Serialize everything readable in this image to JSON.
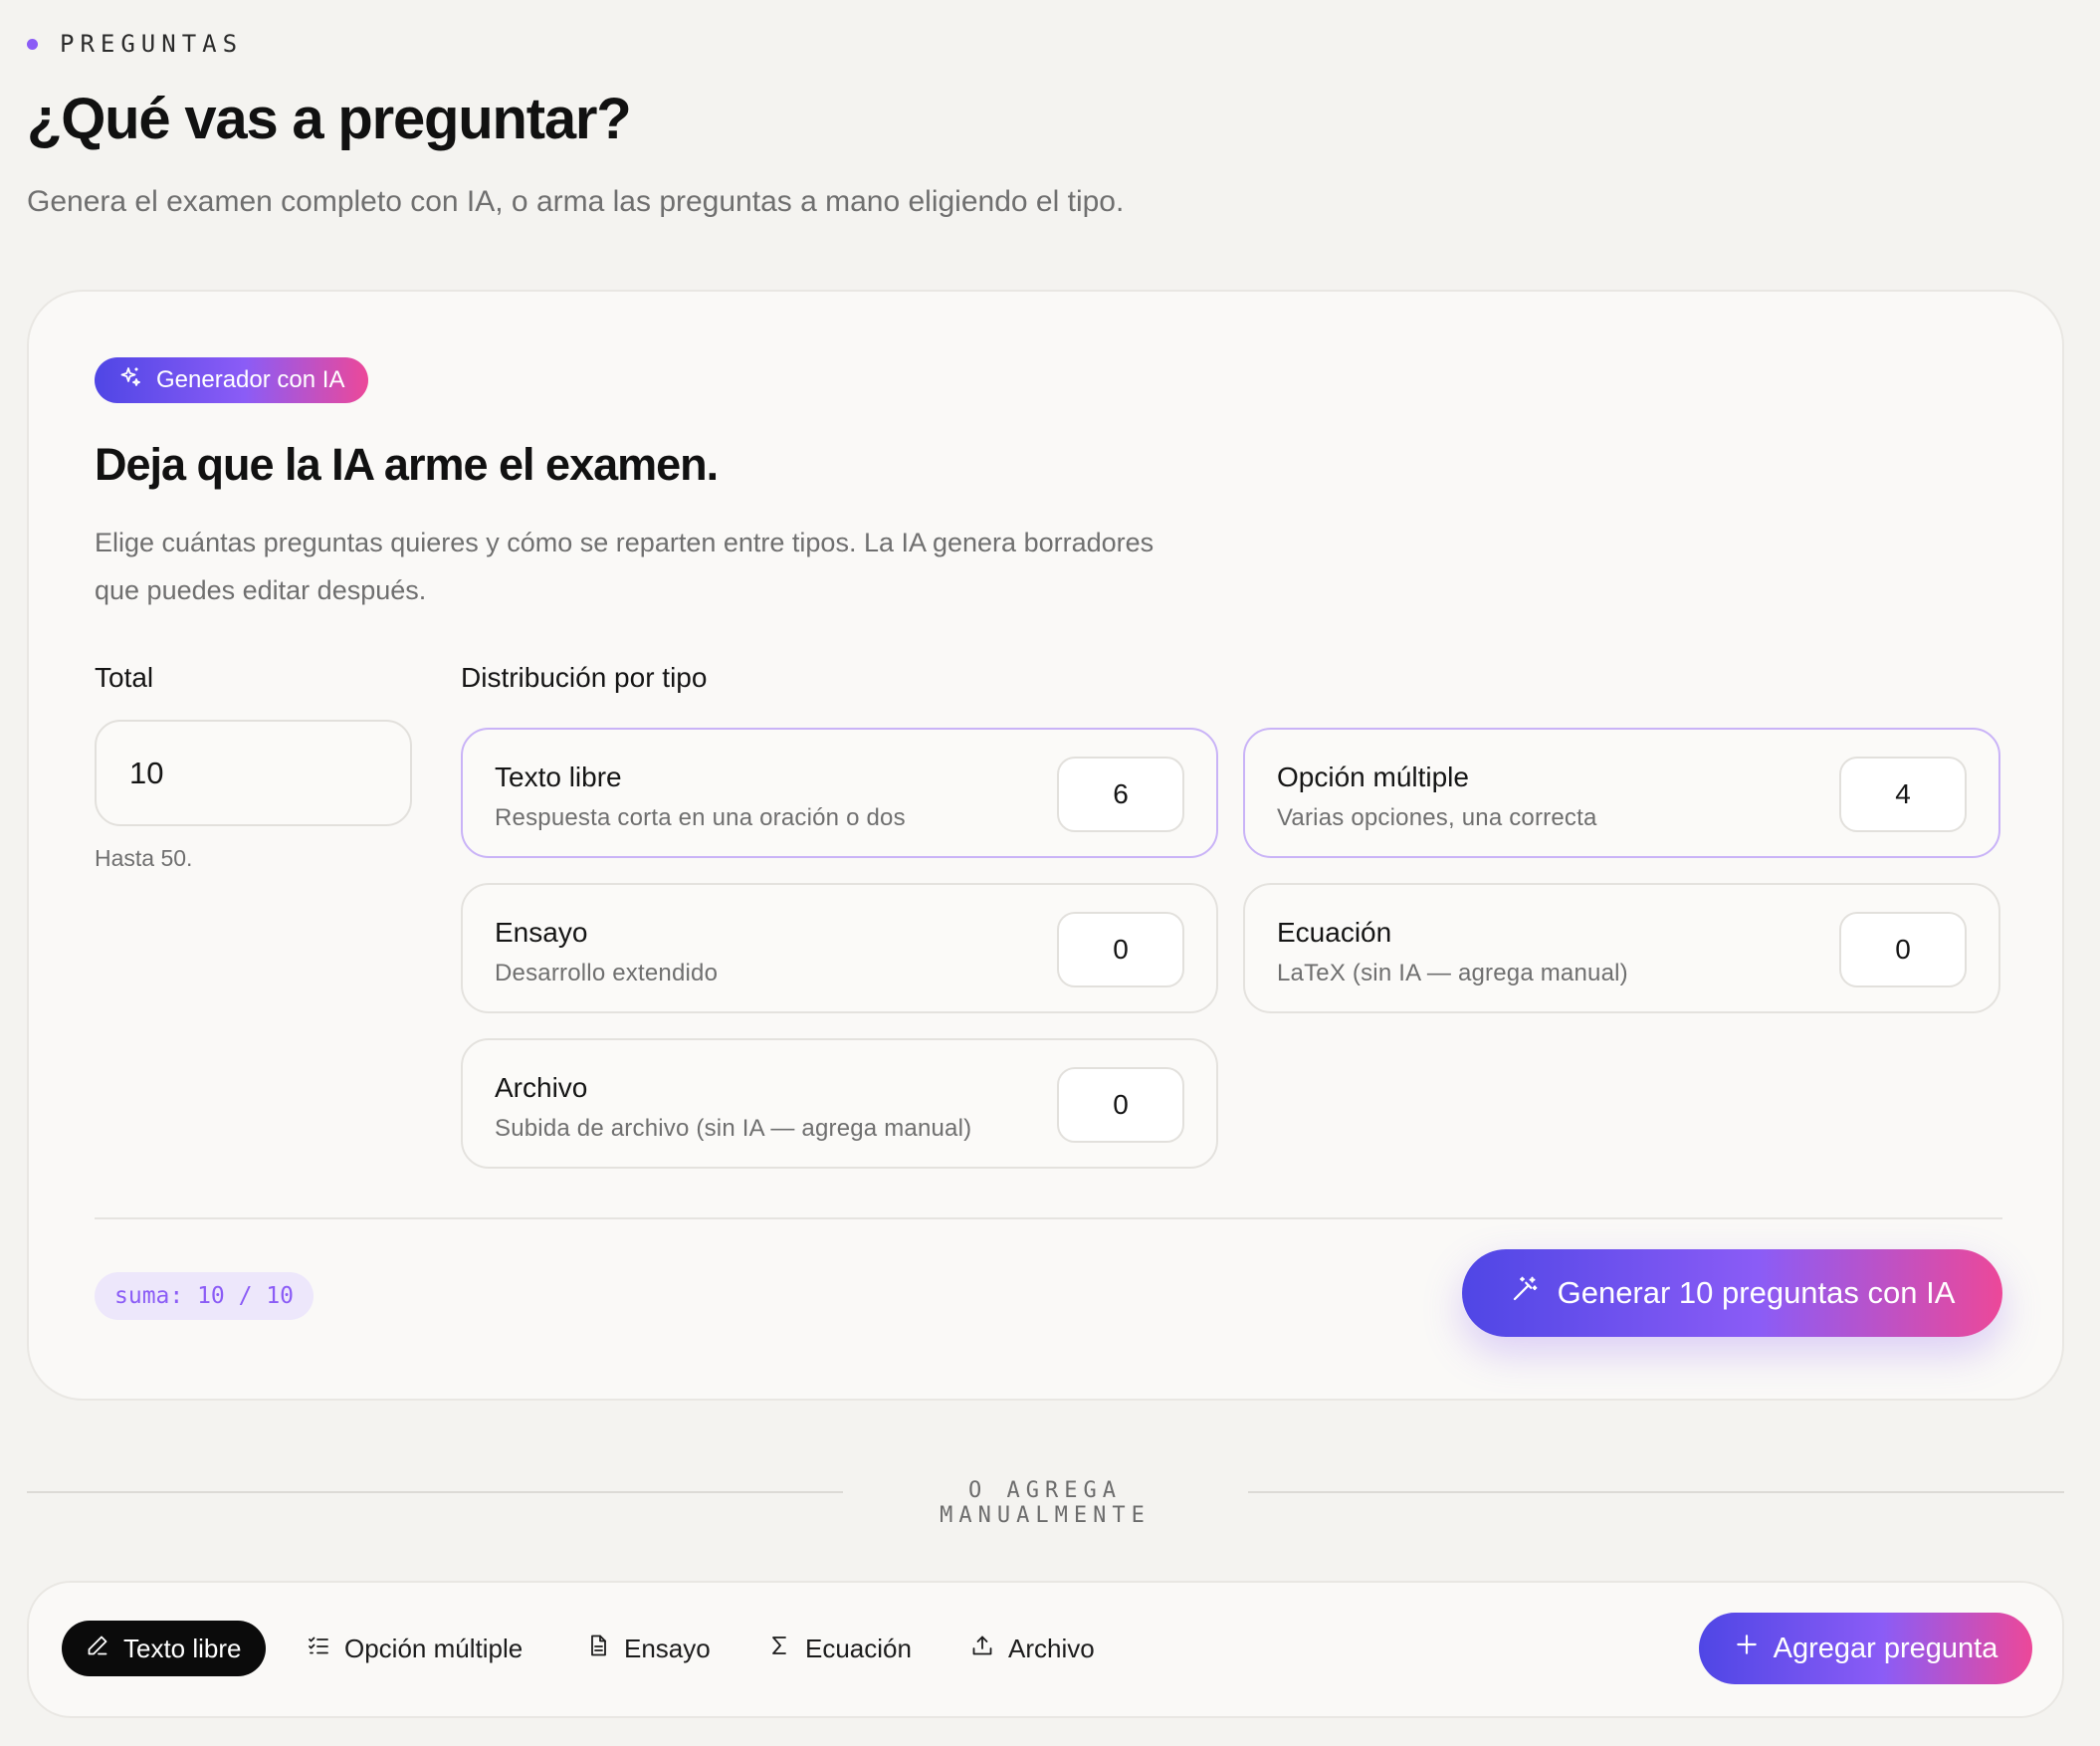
{
  "header": {
    "eyebrow": "PREGUNTAS",
    "title": "¿Qué vas a preguntar?",
    "subtitle": "Genera el examen completo con IA, o arma las preguntas a mano eligiendo el tipo."
  },
  "generator": {
    "badge": "Generador con IA",
    "title": "Deja que la IA arme el examen.",
    "description_line1": "Elige cuántas preguntas quieres y cómo se reparten entre tipos. La IA genera borradores",
    "description_line2": "que puedes editar después.",
    "total_label": "Total",
    "total_value": "10",
    "total_hint": "Hasta 50.",
    "distribution_label": "Distribución por tipo",
    "types": [
      {
        "name": "Texto libre",
        "desc": "Respuesta corta en una oración o dos",
        "count": "6",
        "active": true
      },
      {
        "name": "Opción múltiple",
        "desc": "Varias opciones, una correcta",
        "count": "4",
        "active": true
      },
      {
        "name": "Ensayo",
        "desc": "Desarrollo extendido",
        "count": "0",
        "active": false
      },
      {
        "name": "Ecuación",
        "desc": "LaTeX (sin IA — agrega manual)",
        "count": "0",
        "active": false
      },
      {
        "name": "Archivo",
        "desc": "Subida de archivo (sin IA — agrega manual)",
        "count": "0",
        "active": false
      }
    ],
    "sum_badge": "suma: 10 / 10",
    "generate_button": "Generar 10 preguntas con IA"
  },
  "separator": "O AGREGA MANUALMENTE",
  "manual": {
    "types": [
      {
        "label": "Texto libre",
        "icon": "pencil-icon",
        "selected": true
      },
      {
        "label": "Opción múltiple",
        "icon": "checklist-icon",
        "selected": false
      },
      {
        "label": "Ensayo",
        "icon": "document-icon",
        "selected": false
      },
      {
        "label": "Ecuación",
        "icon": "sigma-icon",
        "selected": false
      },
      {
        "label": "Archivo",
        "icon": "upload-icon",
        "selected": false
      }
    ],
    "add_button": "Agregar pregunta"
  },
  "colors": {
    "accent_purple": "#8b5cf6",
    "gradient_start": "#4f46e5",
    "gradient_end": "#ec4899",
    "background": "#f4f3f0"
  }
}
